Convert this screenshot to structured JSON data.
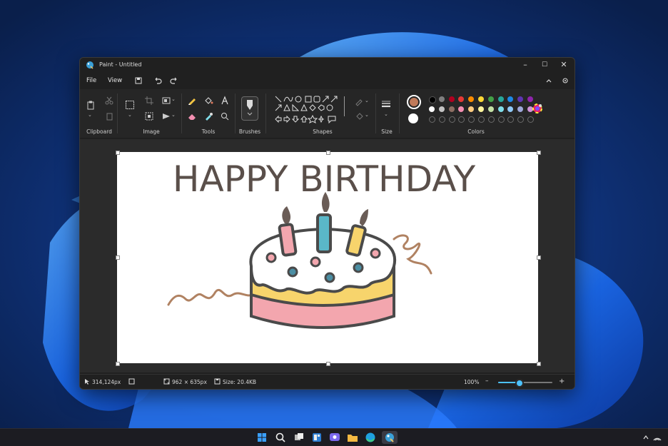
{
  "window": {
    "title": "Paint - Untitled",
    "controls": {
      "minimize": "–",
      "maximize": "☐",
      "close": "✕"
    }
  },
  "menu": {
    "file": "File",
    "view": "View"
  },
  "ribbon": {
    "groups": {
      "clipboard": "Clipboard",
      "image": "Image",
      "tools": "Tools",
      "brushes": "Brushes",
      "shapes": "Shapes",
      "size": "Size",
      "colors": "Colors"
    },
    "primary_color": "#c07a5a",
    "secondary_color": "#ffffff",
    "palette_row1": [
      "#000000",
      "#7f7f7f",
      "#b00020",
      "#e53935",
      "#fb8c00",
      "#fdd835",
      "#43a047",
      "#26a69a",
      "#1e88e5",
      "#5e35b1",
      "#8e24aa"
    ],
    "palette_row2": [
      "#ffffff",
      "#c3c3c3",
      "#8d6e63",
      "#f48fb1",
      "#ffcc80",
      "#fff59d",
      "#c5e1a5",
      "#80deea",
      "#90caf9",
      "#9fa8da",
      "#ce93d8"
    ],
    "palette_row3_empty": 11
  },
  "canvas": {
    "text": "HAPPY BIRTHDAY",
    "text_color": "#5a4f4a"
  },
  "status": {
    "cursor_pos": "314,124px",
    "image_size": "962 × 635px",
    "file_size": "Size: 20.4KB",
    "zoom": "100%",
    "zoom_minus": "–",
    "zoom_plus": "+",
    "zoom_level_fraction": 0.4
  },
  "accent_color": "#4cc2ff"
}
